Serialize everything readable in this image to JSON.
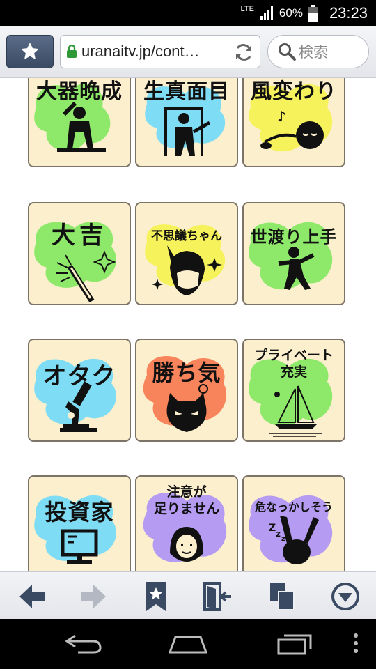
{
  "status": {
    "network": "LTE",
    "battery": "60%",
    "time": "23:23"
  },
  "browser": {
    "url": "uranaitv.jp/cont…",
    "search_placeholder": "検索"
  },
  "tiles": [
    {
      "label": "大器晩成"
    },
    {
      "label": "生真面目"
    },
    {
      "label": "風変わり"
    },
    {
      "label": "大吉"
    },
    {
      "label": "不思議ちゃん"
    },
    {
      "label": "世渡り上手"
    },
    {
      "label": "オタク"
    },
    {
      "label": "勝ち気"
    },
    {
      "label_line1": "プライベート",
      "label_line2": "充実"
    },
    {
      "label": "投資家"
    },
    {
      "label_line1": "注意が",
      "label_line2": "足りません"
    },
    {
      "label": "危なっかしそう"
    }
  ],
  "colors": {
    "tile_bg": "#fcefcd",
    "blob_green": "#8ee86a",
    "blob_cyan": "#7fdcf5",
    "blob_yellow": "#f6f25c",
    "blob_orange": "#f7845a",
    "blob_purple": "#b59cf2"
  }
}
